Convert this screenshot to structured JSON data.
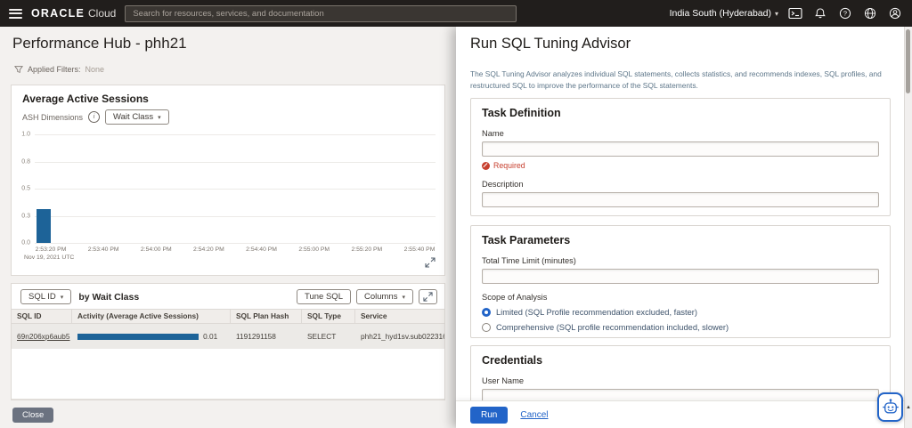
{
  "colors": {
    "accent_blue": "#2264c8",
    "error_red": "#c7402f",
    "bar_blue": "#1d6398",
    "topbar_bg": "#211e1c"
  },
  "icons": {
    "chevron_down": "▾",
    "info": "i",
    "scroll_up_arrow": "▲"
  },
  "topbar": {
    "brand_primary": "ORACLE",
    "brand_secondary": "Cloud",
    "search_placeholder": "Search for resources, services, and documentation",
    "region_label": "India South (Hyderabad)"
  },
  "main": {
    "page_title": "Performance Hub - phh21",
    "applied_filters_label": "Applied Filters:",
    "applied_filters_value": "None",
    "close_button": "Close"
  },
  "chart_panel": {
    "title": "Average Active Sessions",
    "ash_dimensions_label": "ASH Dimensions",
    "wait_class_button": "Wait Class"
  },
  "chart_data": {
    "type": "bar",
    "title": "Average Active Sessions",
    "ylim": [
      0,
      1
    ],
    "y_tick_labels": [
      "1.0",
      "0.8",
      "0.5",
      "0.3",
      "0.0"
    ],
    "x_tick_labels": [
      "2:53:20 PM",
      "2:53:40 PM",
      "2:54:00 PM",
      "2:54:20 PM",
      "2:54:40 PM",
      "2:55:00 PM",
      "2:55:20 PM",
      "2:55:40 PM"
    ],
    "x_axis_caption": "Nov 19, 2021 UTC",
    "bar_color": "#1d6398",
    "bars": [
      {
        "time": "2:53:25 PM",
        "value": 0.31,
        "x_fraction": 0.005
      }
    ]
  },
  "sql_panel": {
    "sql_id_button": "SQL ID",
    "group_by_label": "by Wait Class",
    "tune_sql_button": "Tune SQL",
    "columns_button": "Columns",
    "headers": [
      "SQL ID",
      "Activity (Average Active Sessions)",
      "SQL Plan Hash",
      "SQL Type",
      "Service"
    ],
    "row": {
      "sql_id": "69n206xp6aub5",
      "activity_value": "0.01",
      "activity_bar_fraction": 0.82,
      "sql_plan_hash": "1191291158",
      "sql_type": "SELECT",
      "service": "phh21_hyd1sv.sub022316..."
    }
  },
  "drawer": {
    "title": "Run SQL Tuning Advisor",
    "description": "The SQL Tuning Advisor analyzes individual SQL statements, collects statistics, and recommends indexes, SQL profiles, and restructured SQL to improve the performance of the SQL statements.",
    "task_definition": {
      "title": "Task Definition",
      "name_label": "Name",
      "name_value": "",
      "required_message": "Required",
      "description_label": "Description",
      "description_value": ""
    },
    "task_parameters": {
      "title": "Task Parameters",
      "time_limit_label": "Total Time Limit (minutes)",
      "time_limit_value": "",
      "scope_label": "Scope of Analysis",
      "options": [
        {
          "label": "Limited (SQL Profile recommendation excluded, faster)",
          "selected": true
        },
        {
          "label": "Comprehensive (SQL profile recommendation included, slower)",
          "selected": false
        }
      ]
    },
    "credentials": {
      "title": "Credentials",
      "user_name_label": "User Name",
      "user_name_value": ""
    },
    "footer": {
      "run_button": "Run",
      "cancel_link": "Cancel"
    }
  }
}
